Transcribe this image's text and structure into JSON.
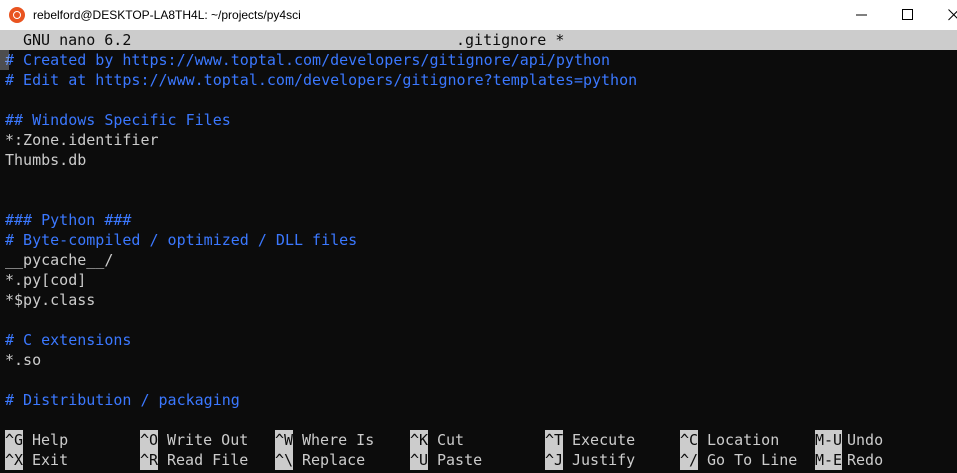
{
  "window": {
    "title": "rebelford@DESKTOP-LA8TH4L: ~/projects/py4sci",
    "icon": "ubuntu-icon",
    "controls": [
      "minimize-icon",
      "maximize-icon",
      "close-icon"
    ]
  },
  "editor": {
    "app": "GNU nano 6.2",
    "filename": ".gitignore *",
    "lines": [
      {
        "text": "# Created by https://www.toptal.com/developers/gitignore/api/python",
        "style": "comment"
      },
      {
        "text": "# Edit at https://www.toptal.com/developers/gitignore?templates=python",
        "style": "comment"
      },
      {
        "text": "",
        "style": "plain"
      },
      {
        "text": "## Windows Specific Files",
        "style": "comment"
      },
      {
        "text": "*:Zone.identifier",
        "style": "plain"
      },
      {
        "text": "Thumbs.db",
        "style": "plain"
      },
      {
        "text": "",
        "style": "plain"
      },
      {
        "text": "",
        "style": "plain"
      },
      {
        "text": "### Python ###",
        "style": "comment"
      },
      {
        "text": "# Byte-compiled / optimized / DLL files",
        "style": "comment"
      },
      {
        "text": "__pycache__/",
        "style": "plain"
      },
      {
        "text": "*.py[cod]",
        "style": "plain"
      },
      {
        "text": "*$py.class",
        "style": "plain"
      },
      {
        "text": "",
        "style": "plain"
      },
      {
        "text": "# C extensions",
        "style": "comment"
      },
      {
        "text": "*.so",
        "style": "plain"
      },
      {
        "text": "",
        "style": "plain"
      },
      {
        "text": "# Distribution / packaging",
        "style": "comment"
      }
    ],
    "shortcuts_row1": [
      {
        "key": "^G",
        "label": "Help"
      },
      {
        "key": "^O",
        "label": "Write Out"
      },
      {
        "key": "^W",
        "label": "Where Is"
      },
      {
        "key": "^K",
        "label": "Cut"
      },
      {
        "key": "^T",
        "label": "Execute"
      },
      {
        "key": "^C",
        "label": "Location"
      },
      {
        "key": "M-U",
        "label": "Undo"
      }
    ],
    "shortcuts_row2": [
      {
        "key": "^X",
        "label": "Exit"
      },
      {
        "key": "^R",
        "label": "Read File"
      },
      {
        "key": "^\\",
        "label": "Replace"
      },
      {
        "key": "^U",
        "label": "Paste"
      },
      {
        "key": "^J",
        "label": "Justify"
      },
      {
        "key": "^/",
        "label": "Go To Line"
      },
      {
        "key": "M-E",
        "label": "Redo"
      }
    ]
  },
  "colors": {
    "background": "#0c0c0c",
    "foreground": "#cccccc",
    "comment": "#3b78ff",
    "title_bar": "#ffffff"
  }
}
